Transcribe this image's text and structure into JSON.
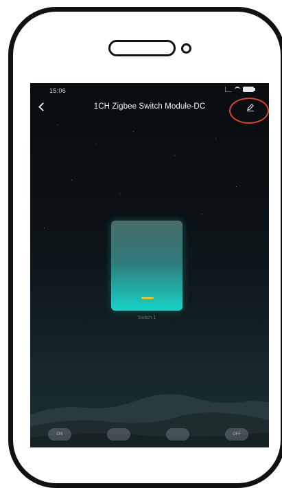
{
  "status_bar": {
    "time": "15:06"
  },
  "header": {
    "title": "1CH Zigbee Switch Module-DC"
  },
  "switch": {
    "label": "Switch 1",
    "state": "on",
    "indicator_color": "#e8c530",
    "glow_color": "#16d3c8"
  },
  "actions": [
    {
      "label": "ON"
    },
    {
      "label": ""
    },
    {
      "label": ""
    },
    {
      "label": "OFF"
    }
  ],
  "colors": {
    "highlight_ring": "#e0442d",
    "frame": "#111111"
  }
}
